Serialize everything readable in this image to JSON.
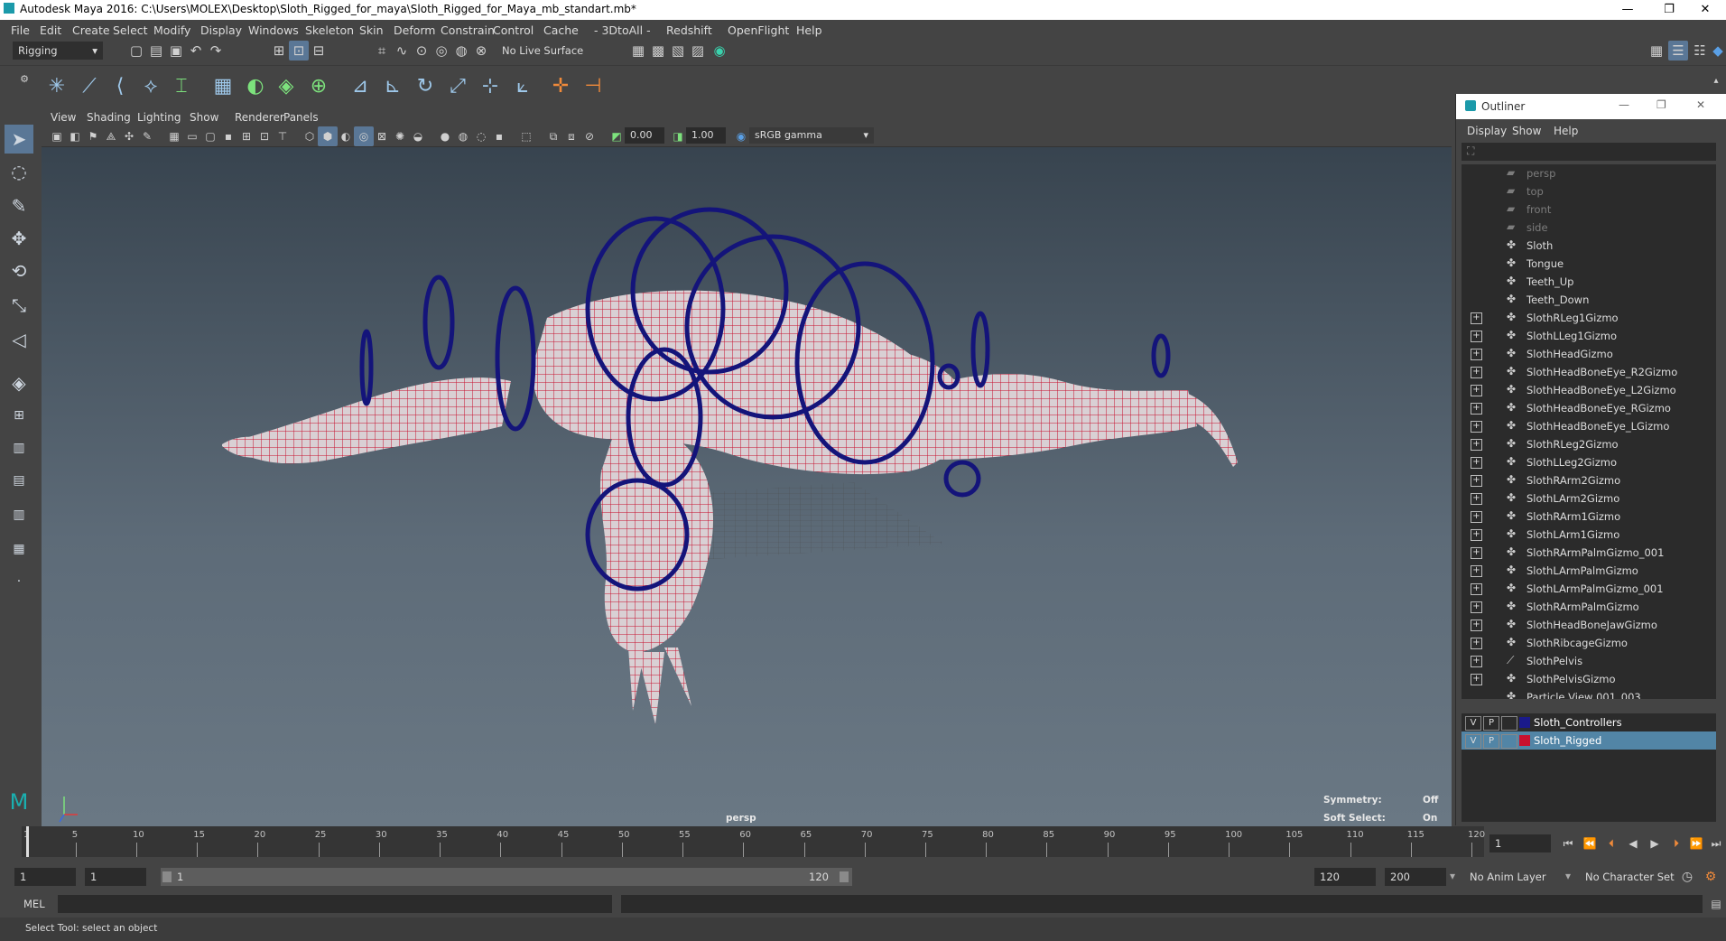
{
  "window": {
    "title": "Autodesk Maya 2016: C:\\Users\\MOLEX\\Desktop\\Sloth_Rigged_for_maya\\Sloth_Rigged_for_Maya_mb_standart.mb*",
    "min": "—",
    "restore": "❐",
    "close": "✕"
  },
  "menu": [
    "File",
    "Edit",
    "Create",
    "Select",
    "Modify",
    "Display",
    "Windows",
    "Skeleton",
    "Skin",
    "Deform",
    "Constrain",
    "Control",
    "Cache",
    "- 3DtoAll -",
    "Redshift",
    "OpenFlight",
    "Help"
  ],
  "status": {
    "mode": "Rigging",
    "live_surface": "No Live Surface"
  },
  "viewport": {
    "menu": [
      "View",
      "Shading",
      "Lighting",
      "Show",
      "Renderer",
      "Panels"
    ],
    "exposure": "0.00",
    "gamma": "1.00",
    "color_space": "sRGB gamma",
    "camera_label": "persp",
    "symmetry_label": "Symmetry:",
    "symmetry_value": "Off",
    "soft_select_label": "Soft Select:",
    "soft_select_value": "On"
  },
  "outliner": {
    "title": "Outliner",
    "menu": [
      "Display",
      "Show",
      "Help"
    ],
    "items": [
      {
        "label": "persp",
        "dim": true,
        "expand": false,
        "icon": "camera-icon"
      },
      {
        "label": "top",
        "dim": true,
        "expand": false,
        "icon": "camera-icon"
      },
      {
        "label": "front",
        "dim": true,
        "expand": false,
        "icon": "camera-icon"
      },
      {
        "label": "side",
        "dim": true,
        "expand": false,
        "icon": "camera-icon"
      },
      {
        "label": "Sloth",
        "dim": false,
        "expand": false,
        "icon": "mesh-icon"
      },
      {
        "label": "Tongue",
        "dim": false,
        "expand": false,
        "icon": "mesh-icon"
      },
      {
        "label": "Teeth_Up",
        "dim": false,
        "expand": false,
        "icon": "mesh-icon"
      },
      {
        "label": "Teeth_Down",
        "dim": false,
        "expand": false,
        "icon": "mesh-icon"
      },
      {
        "label": "SlothRLeg1Gizmo",
        "dim": false,
        "expand": true,
        "icon": "mesh-icon"
      },
      {
        "label": "SlothLLeg1Gizmo",
        "dim": false,
        "expand": true,
        "icon": "mesh-icon"
      },
      {
        "label": "SlothHeadGizmo",
        "dim": false,
        "expand": true,
        "icon": "mesh-icon"
      },
      {
        "label": "SlothHeadBoneEye_R2Gizmo",
        "dim": false,
        "expand": true,
        "icon": "mesh-icon"
      },
      {
        "label": "SlothHeadBoneEye_L2Gizmo",
        "dim": false,
        "expand": true,
        "icon": "mesh-icon"
      },
      {
        "label": "SlothHeadBoneEye_RGizmo",
        "dim": false,
        "expand": true,
        "icon": "mesh-icon"
      },
      {
        "label": "SlothHeadBoneEye_LGizmo",
        "dim": false,
        "expand": true,
        "icon": "mesh-icon"
      },
      {
        "label": "SlothRLeg2Gizmo",
        "dim": false,
        "expand": true,
        "icon": "mesh-icon"
      },
      {
        "label": "SlothLLeg2Gizmo",
        "dim": false,
        "expand": true,
        "icon": "mesh-icon"
      },
      {
        "label": "SlothRArm2Gizmo",
        "dim": false,
        "expand": true,
        "icon": "mesh-icon"
      },
      {
        "label": "SlothLArm2Gizmo",
        "dim": false,
        "expand": true,
        "icon": "mesh-icon"
      },
      {
        "label": "SlothRArm1Gizmo",
        "dim": false,
        "expand": true,
        "icon": "mesh-icon"
      },
      {
        "label": "SlothLArm1Gizmo",
        "dim": false,
        "expand": true,
        "icon": "mesh-icon"
      },
      {
        "label": "SlothRArmPalmGizmo_001",
        "dim": false,
        "expand": true,
        "icon": "mesh-icon"
      },
      {
        "label": "SlothLArmPalmGizmo",
        "dim": false,
        "expand": true,
        "icon": "mesh-icon"
      },
      {
        "label": "SlothLArmPalmGizmo_001",
        "dim": false,
        "expand": true,
        "icon": "mesh-icon"
      },
      {
        "label": "SlothRArmPalmGizmo",
        "dim": false,
        "expand": true,
        "icon": "mesh-icon"
      },
      {
        "label": "SlothHeadBoneJawGizmo",
        "dim": false,
        "expand": true,
        "icon": "mesh-icon"
      },
      {
        "label": "SlothRibcageGizmo",
        "dim": false,
        "expand": true,
        "icon": "mesh-icon"
      },
      {
        "label": "SlothPelvis",
        "dim": false,
        "expand": true,
        "icon": "joint-icon"
      },
      {
        "label": "SlothPelvisGizmo",
        "dim": false,
        "expand": true,
        "icon": "mesh-icon"
      },
      {
        "label": "Particle View 001_003",
        "dim": false,
        "expand": false,
        "icon": "mesh-icon"
      }
    ],
    "layers": [
      {
        "v": "V",
        "p": "P",
        "name": "Sloth_Controllers",
        "color": "#1a1a8a",
        "selected": false
      },
      {
        "v": "V",
        "p": "P",
        "name": "Sloth_Rigged",
        "color": "#c8102e",
        "selected": true
      }
    ]
  },
  "timeline": {
    "ticks": [
      1,
      5,
      10,
      15,
      20,
      25,
      30,
      35,
      40,
      45,
      50,
      55,
      60,
      65,
      70,
      75,
      80,
      85,
      90,
      95,
      100,
      105,
      110,
      115,
      120
    ],
    "current_frame": "1"
  },
  "range": {
    "start": "1",
    "anim_start": "1",
    "slider_start": "1",
    "slider_end": "120",
    "anim_end": "120",
    "end": "200",
    "anim_layer": "No Anim Layer",
    "char_set": "No Character Set"
  },
  "cmd": {
    "label": "MEL"
  },
  "help": {
    "text": "Select Tool: select an object"
  },
  "colors": {
    "wire": "#c8102e",
    "gizmo": "#14147a",
    "accent": "#5aa0e6"
  }
}
